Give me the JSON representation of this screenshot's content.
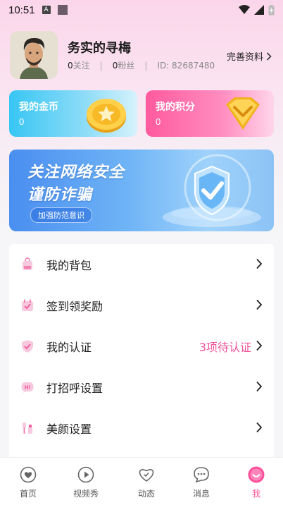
{
  "status_bar": {
    "time": "10:51",
    "icons": [
      "notification-a-icon",
      "app-square-icon",
      "wifi-icon",
      "signal-icon",
      "battery-charging-icon"
    ]
  },
  "profile": {
    "nickname": "务实的寻梅",
    "following_count": "0",
    "following_label": "关注",
    "followers_count": "0",
    "followers_label": "粉丝",
    "id_text": "ID: 82687480",
    "edit_label": "完善资料"
  },
  "cards": {
    "coins": {
      "title": "我的金币",
      "value": "0"
    },
    "points": {
      "title": "我的积分",
      "value": "0"
    }
  },
  "banner": {
    "line1": "关注网络安全",
    "line2": "谨防诈骗",
    "tag": "加强防范意识"
  },
  "menu": {
    "items": [
      {
        "label": "我的背包",
        "icon": "backpack-icon",
        "extra": ""
      },
      {
        "label": "签到领奖励",
        "icon": "calendar-checkin-icon",
        "extra": ""
      },
      {
        "label": "我的认证",
        "icon": "shield-check-icon",
        "extra": "3项待认证"
      },
      {
        "label": "打招呼设置",
        "icon": "greeting-hi-icon",
        "extra": ""
      },
      {
        "label": "美颜设置",
        "icon": "beauty-cosmetics-icon",
        "extra": ""
      }
    ]
  },
  "tabbar": {
    "tabs": [
      {
        "label": "首页",
        "icon": "home-heart-icon"
      },
      {
        "label": "视频秀",
        "icon": "video-play-icon"
      },
      {
        "label": "动态",
        "icon": "moments-heart-icon"
      },
      {
        "label": "消息",
        "icon": "message-bubble-icon"
      },
      {
        "label": "我",
        "icon": "me-smile-icon"
      }
    ],
    "active_index": 4
  },
  "colors": {
    "accent": "#ff4f9a",
    "coin_card": "#37c6f3",
    "points_card": "#ff5a9e"
  }
}
